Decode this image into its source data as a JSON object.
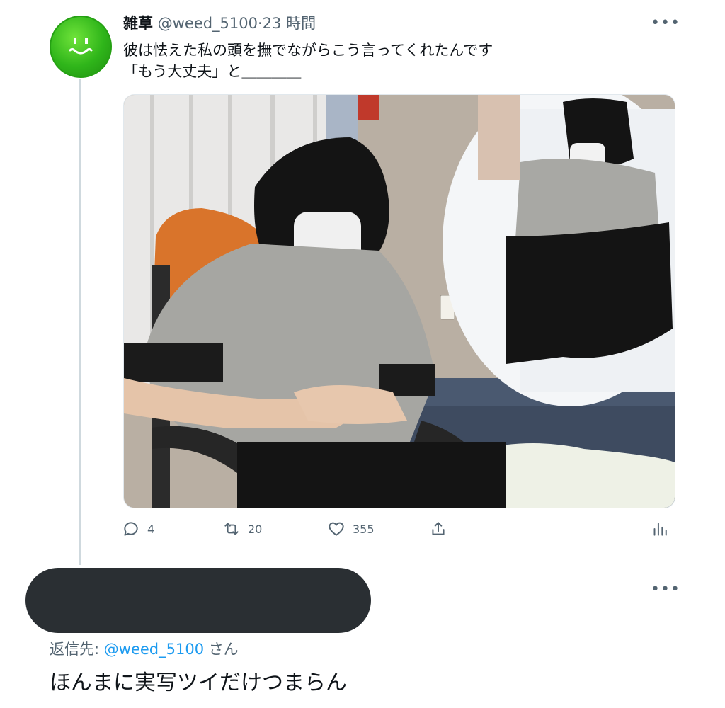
{
  "tweet": {
    "author_name": "雑草",
    "handle": "@weed_5100",
    "separator": "·",
    "time": "23 時間",
    "more_label": "•••",
    "text_line1": "彼は怯えた私の頭を撫でながらこう言ってくれたんです",
    "text_line2": "「もう大丈夫」と＿＿＿＿",
    "avatar_icon": "smiley-face-icon",
    "avatar_color": "#2fb51a",
    "counts": {
      "replies": "4",
      "retweets": "20",
      "likes": "355"
    }
  },
  "reply": {
    "more_label": "•••",
    "reply_to_prefix": "返信先: ",
    "reply_to_handle": "@weed_5100",
    "reply_to_suffix": " さん",
    "text": "ほんまに実写ツイだけつまらん"
  },
  "colors": {
    "secondary_text": "#536471",
    "link": "#1d9bf0",
    "redaction": "#2a2f33"
  }
}
